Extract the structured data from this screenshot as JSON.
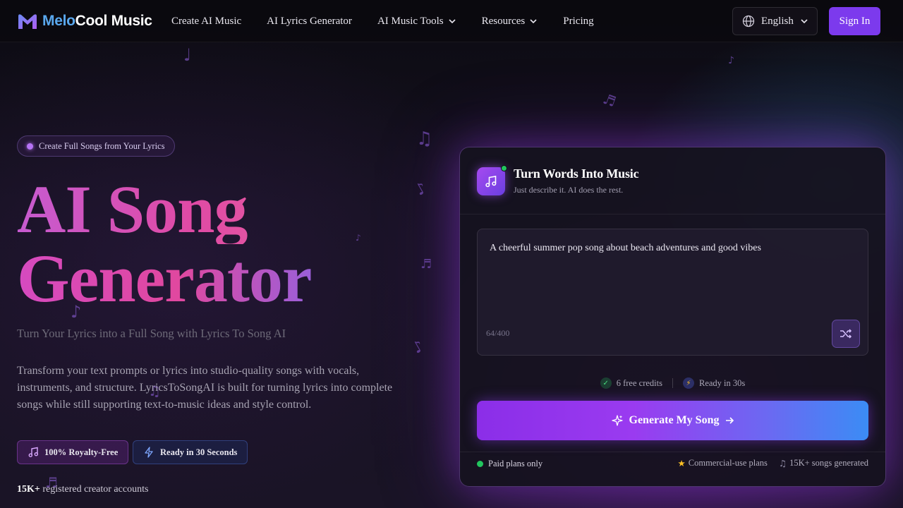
{
  "header": {
    "logo": {
      "part1": "Melo",
      "part2": "Cool Music"
    },
    "nav": [
      {
        "label": "Create AI Music",
        "dropdown": false
      },
      {
        "label": "AI Lyrics Generator",
        "dropdown": false
      },
      {
        "label": "AI Music Tools",
        "dropdown": true
      },
      {
        "label": "Resources",
        "dropdown": true
      },
      {
        "label": "Pricing",
        "dropdown": false
      }
    ],
    "language": "English",
    "sign_in": "Sign In"
  },
  "hero": {
    "badge": "Create Full Songs from Your Lyrics",
    "title_line1": "AI Song",
    "title_line2": "Generator",
    "subtitle": "Turn Your Lyrics into a Full Song with Lyrics To Song AI",
    "description": "Transform your text prompts or lyrics into studio-quality songs with vocals, instruments, and structure. LyricsToSongAI is built for turning lyrics into complete songs while still supporting text-to-music ideas and style control.",
    "pill_royalty": "100% Royalty-Free",
    "pill_ready": "Ready in 30 Seconds",
    "accounts_count": "15K+",
    "accounts_label": "registered creator accounts"
  },
  "card": {
    "title": "Turn Words Into Music",
    "subtitle": "Just describe it. AI does the rest.",
    "prompt_value": "A cheerful summer pop song about beach adventures and good vibes",
    "char_counter": "64/400",
    "credits": "6 free credits",
    "ready": "Ready in 30s",
    "generate_label": "Generate My Song",
    "footer_left": "Paid plans only",
    "footer_commercial": "Commercial-use plans",
    "footer_songs": "15K+ songs generated"
  },
  "colors": {
    "accent": "#7c3aed",
    "gradient_start": "#8b2ee8",
    "gradient_end": "#3b8cf5",
    "title_pink": "#e04aa5",
    "online_green": "#22c55e"
  },
  "icons": {
    "logo": "melocool-logo-icon",
    "language": "globe-icon",
    "card": "music-note-icon",
    "shuffle": "shuffle-icon",
    "credits": "check-icon",
    "ready": "lightning-icon",
    "generate": "sparkle-icon",
    "arrow": "arrow-right-icon"
  }
}
